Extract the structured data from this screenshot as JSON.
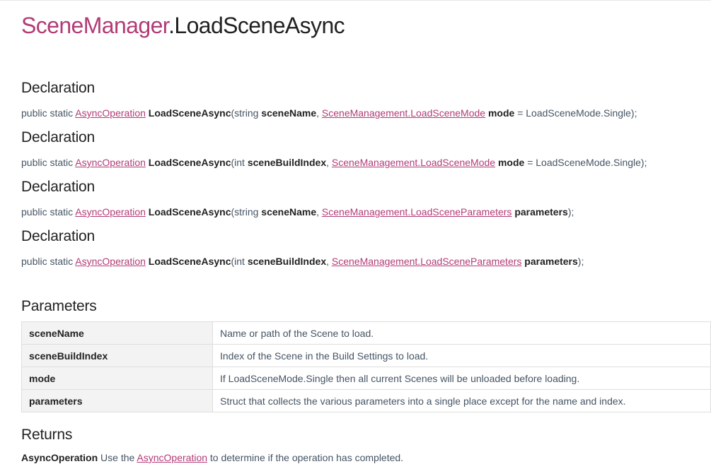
{
  "title": {
    "class_name": "SceneManager",
    "separator": ".",
    "method_name": "LoadSceneAsync"
  },
  "declarations": [
    {
      "heading": "Declaration",
      "prefix": "public static",
      "return_type_link": "AsyncOperation",
      "method": "LoadSceneAsync",
      "open": "(string",
      "param1_name": "sceneName",
      "comma": ",",
      "param2_type_link": "SceneManagement.LoadSceneMode",
      "param2_name": "mode",
      "tail": "= LoadSceneMode.Single);"
    },
    {
      "heading": "Declaration",
      "prefix": "public static",
      "return_type_link": "AsyncOperation",
      "method": "LoadSceneAsync",
      "open": "(int",
      "param1_name": "sceneBuildIndex",
      "comma": ",",
      "param2_type_link": "SceneManagement.LoadSceneMode",
      "param2_name": "mode",
      "tail": "= LoadSceneMode.Single);"
    },
    {
      "heading": "Declaration",
      "prefix": "public static",
      "return_type_link": "AsyncOperation",
      "method": "LoadSceneAsync",
      "open": "(string",
      "param1_name": "sceneName",
      "comma": ",",
      "param2_type_link": "SceneManagement.LoadSceneParameters",
      "param2_name": "parameters",
      "tail": ");"
    },
    {
      "heading": "Declaration",
      "prefix": "public static",
      "return_type_link": "AsyncOperation",
      "method": "LoadSceneAsync",
      "open": "(int",
      "param1_name": "sceneBuildIndex",
      "comma": ",",
      "param2_type_link": "SceneManagement.LoadSceneParameters",
      "param2_name": "parameters",
      "tail": ");"
    }
  ],
  "parameters": {
    "heading": "Parameters",
    "rows": [
      {
        "name": "sceneName",
        "description": "Name or path of the Scene to load."
      },
      {
        "name": "sceneBuildIndex",
        "description": "Index of the Scene in the Build Settings to load."
      },
      {
        "name": "mode",
        "description": "If LoadSceneMode.Single then all current Scenes will be unloaded before loading."
      },
      {
        "name": "parameters",
        "description": "Struct that collects the various parameters into a single place except for the name and index."
      }
    ]
  },
  "returns": {
    "heading": "Returns",
    "type": "AsyncOperation",
    "text_before": "Use the",
    "link": "AsyncOperation",
    "text_after": "to determine if the operation has completed."
  },
  "colors": {
    "accent": "#b23b77",
    "heading": "#222222",
    "body_text": "#455463",
    "table_border": "#dedede",
    "table_name_bg": "#f3f3f3"
  }
}
